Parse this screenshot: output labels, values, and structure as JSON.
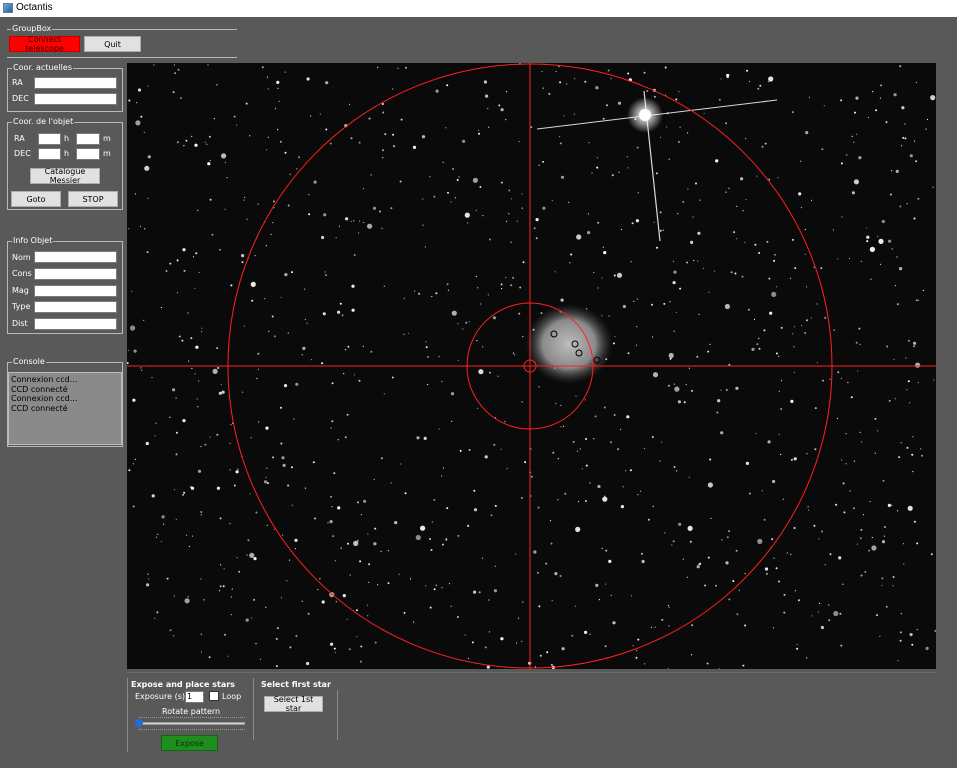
{
  "window": {
    "title": "Octantis"
  },
  "group_box": {
    "title": "GroupBox",
    "connect_label": "Connect telescope",
    "quit_label": "Quit"
  },
  "coor_actuelles": {
    "title": "Coor. actuelles",
    "ra_label": "RA",
    "dec_label": "DEC",
    "ra_value": "",
    "dec_value": ""
  },
  "coor_objet": {
    "title": "Coor. de l'objet",
    "ra_label": "RA",
    "dec_label": "DEC",
    "h_unit": "h",
    "m_unit": "m",
    "catalogue_label": "Catalogue Messier",
    "goto_label": "Goto",
    "stop_label": "STOP"
  },
  "info_objet": {
    "title": "Info Objet",
    "fields": [
      {
        "label": "Nom",
        "value": ""
      },
      {
        "label": "Cons",
        "value": ""
      },
      {
        "label": "Mag",
        "value": ""
      },
      {
        "label": "Type",
        "value": ""
      },
      {
        "label": "Dist",
        "value": ""
      }
    ]
  },
  "console": {
    "title": "Console",
    "lines": [
      "Connexion ccd...",
      "CCD connecté",
      "Connexion ccd...",
      "CCD connecté"
    ]
  },
  "bottom": {
    "expose_title": "Expose and place stars",
    "exposure_label": "Exposure (s)",
    "exposure_value": "1",
    "loop_label": "Loop",
    "rotate_label": "Rotate pattern",
    "expose_button": "Expose",
    "select_title": "Select first star",
    "select_button": "Select 1st star"
  },
  "colors": {
    "background": "#595959",
    "connect_button": "#ff0000",
    "expose_button": "#1e8f1e",
    "reticle": "#ff2020",
    "slider_handle": "#1e6fd9"
  }
}
